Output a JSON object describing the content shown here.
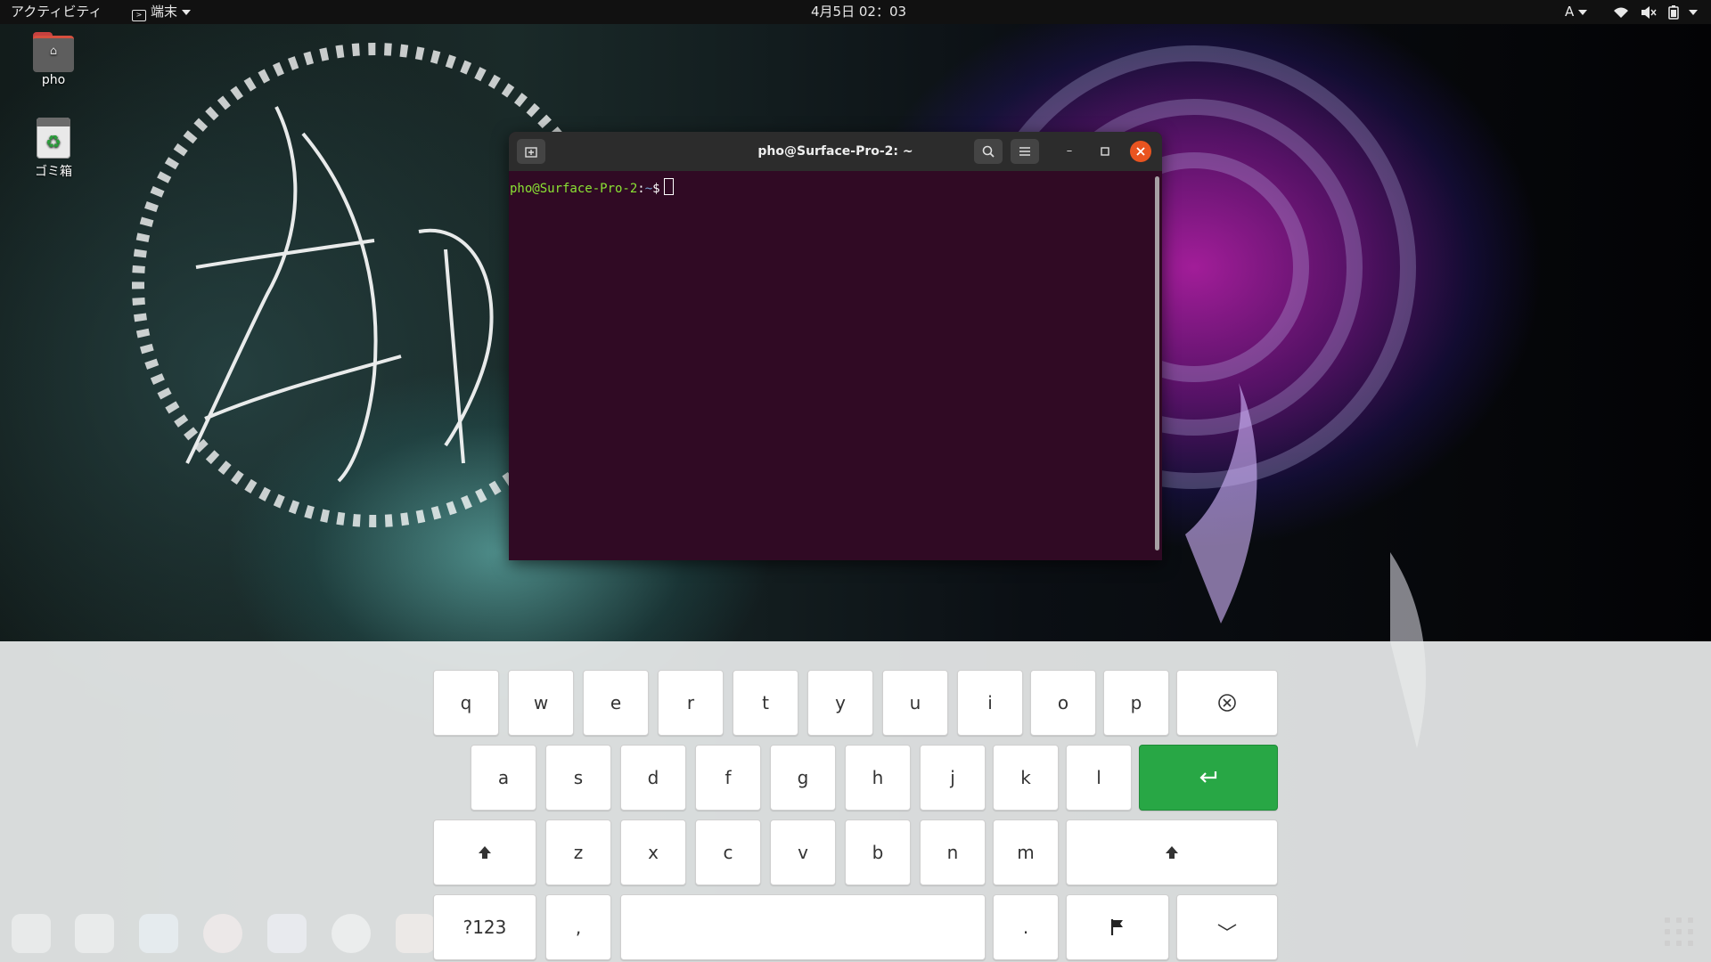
{
  "topbar": {
    "activities": "アクティビティ",
    "app_menu": "端末",
    "clock": "4月5日  02：03",
    "input_method": "A"
  },
  "desktop": {
    "icons": [
      {
        "label": "pho",
        "icon": "home-folder-icon"
      },
      {
        "label": "ゴミ箱",
        "icon": "trash-icon"
      }
    ]
  },
  "terminal": {
    "title": "pho@Surface-Pro-2: ~",
    "prompt_user": "pho@Surface-Pro-2",
    "prompt_sep": ":",
    "prompt_path": "~",
    "prompt_end": "$"
  },
  "keyboard": {
    "row1": [
      "q",
      "w",
      "e",
      "r",
      "t",
      "y",
      "u",
      "i",
      "o",
      "p"
    ],
    "row2": [
      "a",
      "s",
      "d",
      "f",
      "g",
      "h",
      "j",
      "k",
      "l"
    ],
    "row3": [
      "z",
      "x",
      "c",
      "v",
      "b",
      "n",
      "m"
    ],
    "numbers_label": "?123",
    "comma": ",",
    "period": ".",
    "space": ""
  },
  "dock": {
    "icons": [
      "files-icon",
      "terminal-icon",
      "vscode-icon",
      "vivaldi-icon",
      "discord-icon",
      "slack-icon",
      "software-center-icon"
    ]
  },
  "colors": {
    "terminal_bg": "#300a24",
    "prompt_user": "#8ae234",
    "prompt_path": "#729fcf",
    "enter_key": "#28a745",
    "close_button": "#e95420"
  }
}
